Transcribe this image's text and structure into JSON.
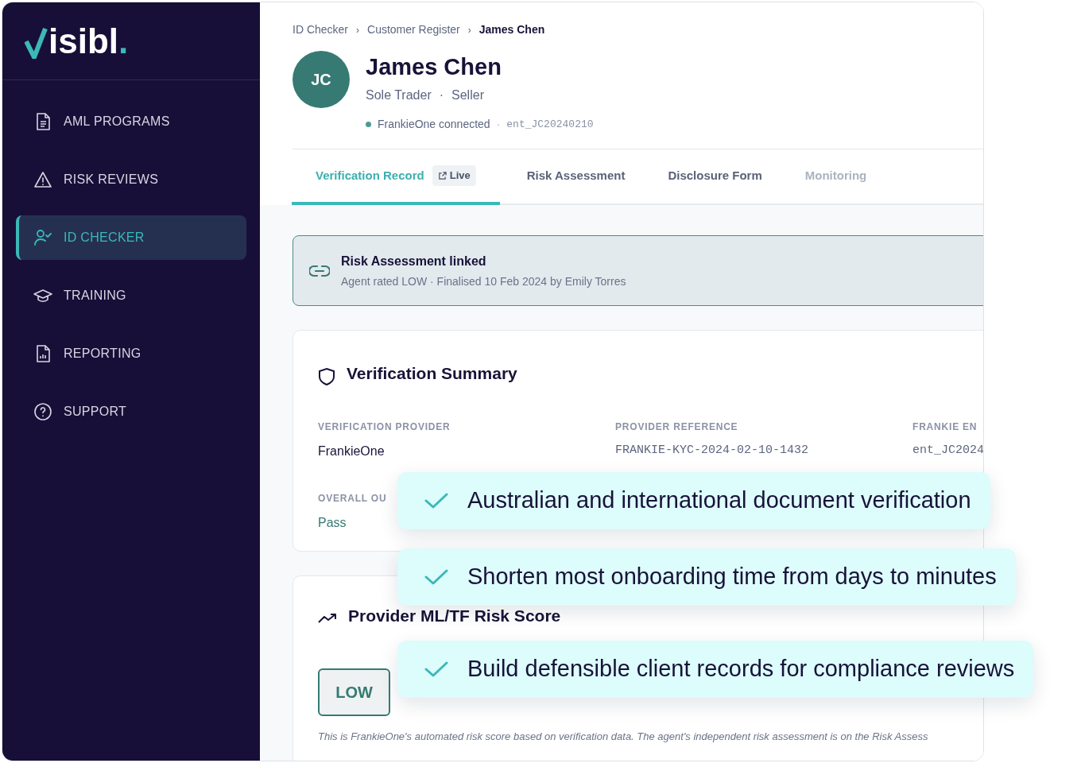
{
  "sidebar": {
    "logo": {
      "text": "isibl",
      "dot": "."
    },
    "items": [
      {
        "label": "AML PROGRAMS",
        "kind": "document",
        "selected": false
      },
      {
        "label": "RISK REVIEWS",
        "kind": "warning",
        "selected": false
      },
      {
        "label": "ID CHECKER",
        "kind": "user",
        "selected": true
      },
      {
        "label": "TRAINING",
        "kind": "training",
        "selected": false
      },
      {
        "label": "REPORTING",
        "kind": "report",
        "selected": false
      },
      {
        "label": "SUPPORT",
        "kind": "help",
        "selected": false
      }
    ]
  },
  "breadcrumb": {
    "separator": "›",
    "items": [
      {
        "label": "ID Checker",
        "current": false
      },
      {
        "label": "Customer Register",
        "current": false
      },
      {
        "label": "James Chen",
        "current": true
      }
    ]
  },
  "profile": {
    "initials": "JC",
    "name": "James Chen",
    "separator": "·",
    "roles": [
      "Sole Trader",
      "Seller"
    ],
    "connection": {
      "label": "FrankieOne connected",
      "connected": true
    },
    "entity_id": "ent_JC20240210"
  },
  "tabs": [
    {
      "label": "Verification Record",
      "badge": "Live",
      "selected": true,
      "disabled": false
    },
    {
      "label": "Risk Assessment",
      "selected": false,
      "disabled": false
    },
    {
      "label": "Disclosure Form",
      "selected": false,
      "disabled": false
    },
    {
      "label": "Monitoring",
      "selected": false,
      "disabled": true
    }
  ],
  "banner": {
    "title": "Risk Assessment linked",
    "detail": "Agent rated LOW · Finalised 10 Feb 2024 by Emily Torres"
  },
  "summary": {
    "title": "Verification Summary",
    "fields": [
      {
        "label": "VERIFICATION PROVIDER",
        "value": "FrankieOne",
        "kind": "text"
      },
      {
        "label": "PROVIDER REFERENCE",
        "value": "FRANKIE-KYC-2024-02-10-1432",
        "kind": "mono"
      },
      {
        "label": "FRANKIE EN",
        "value": "ent_JC2024",
        "kind": "mono"
      },
      {
        "label": "OVERALL OU",
        "value": "Pass",
        "kind": "status"
      }
    ]
  },
  "risk_score": {
    "title": "Provider ML/TF Risk Score",
    "rating": "LOW",
    "note": "This is FrankieOne's automated risk score based on verification data. The agent's independent risk assessment is on the Risk Assess"
  },
  "callouts": [
    "Australian and international document verification",
    "Shorten most onboarding time from days to minutes",
    "Build defensible client records for compliance reviews"
  ]
}
